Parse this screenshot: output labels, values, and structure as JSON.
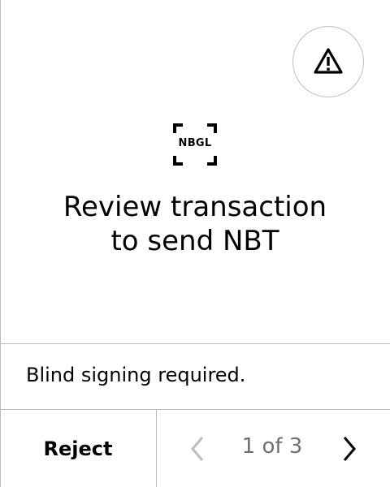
{
  "header": {
    "warning_icon": "warning-triangle-icon"
  },
  "logo": {
    "text": "NBGL",
    "icon": "scan-frame-icon"
  },
  "main": {
    "title_line1": "Review transaction",
    "title_line2": "to send NBT"
  },
  "info": {
    "text": "Blind signing required."
  },
  "footer": {
    "reject_label": "Reject",
    "page_indicator": "1 of 3",
    "prev_icon": "chevron-left-icon",
    "next_icon": "chevron-right-icon",
    "prev_color": "#bdbdbd",
    "next_color": "#000000"
  },
  "colors": {
    "background": "#ffffff",
    "text": "#000000",
    "divider": "#bdbdbd",
    "muted": "#707070"
  }
}
